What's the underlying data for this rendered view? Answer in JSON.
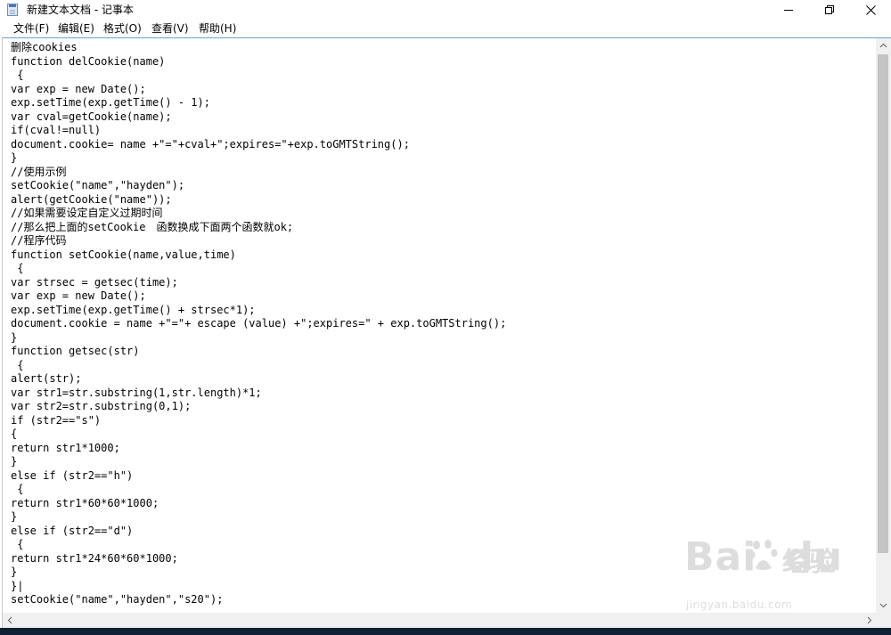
{
  "window": {
    "title": "新建文本文档 - 记事本",
    "controls": [
      "minimize",
      "maximize",
      "close"
    ]
  },
  "menu": {
    "items": [
      "文件(F)",
      "编辑(E)",
      "格式(O)",
      "查看(V)",
      "帮助(H)"
    ]
  },
  "editor": {
    "lines": [
      "删除cookies",
      "function delCookie(name)",
      " {",
      "var exp = new Date();",
      "exp.setTime(exp.getTime() - 1);",
      "var cval=getCookie(name);",
      "if(cval!=null)",
      "document.cookie= name +\"=\"+cval+\";expires=\"+exp.toGMTString();",
      "}",
      "//使用示例",
      "setCookie(\"name\",\"hayden\");",
      "alert(getCookie(\"name\"));",
      "//如果需要设定自定义过期时间",
      "//那么把上面的setCookie　函数换成下面两个函数就ok;",
      "//程序代码",
      "function setCookie(name,value,time)",
      " {",
      "var strsec = getsec(time);",
      "var exp = new Date();",
      "exp.setTime(exp.getTime() + strsec*1);",
      "document.cookie = name +\"=\"+ escape (value) +\";expires=\" + exp.toGMTString();",
      "}",
      "function getsec(str)",
      " {",
      "alert(str);",
      "var str1=str.substring(1,str.length)*1;",
      "var str2=str.substring(0,1);",
      "if (str2==\"s\")",
      "{",
      "return str1*1000;",
      "}",
      "else if (str2==\"h\")",
      " {",
      "return str1*60*60*1000;",
      "}",
      "else if (str2==\"d\")",
      " {",
      "return str1*24*60*60*1000;",
      "}",
      "}|",
      "setCookie(\"name\",\"hayden\",\"s20\");"
    ]
  },
  "watermark": {
    "logo": "Bai",
    "logo_tail": "du",
    "cn": "经验",
    "url": "jingyan.baidu.com"
  }
}
